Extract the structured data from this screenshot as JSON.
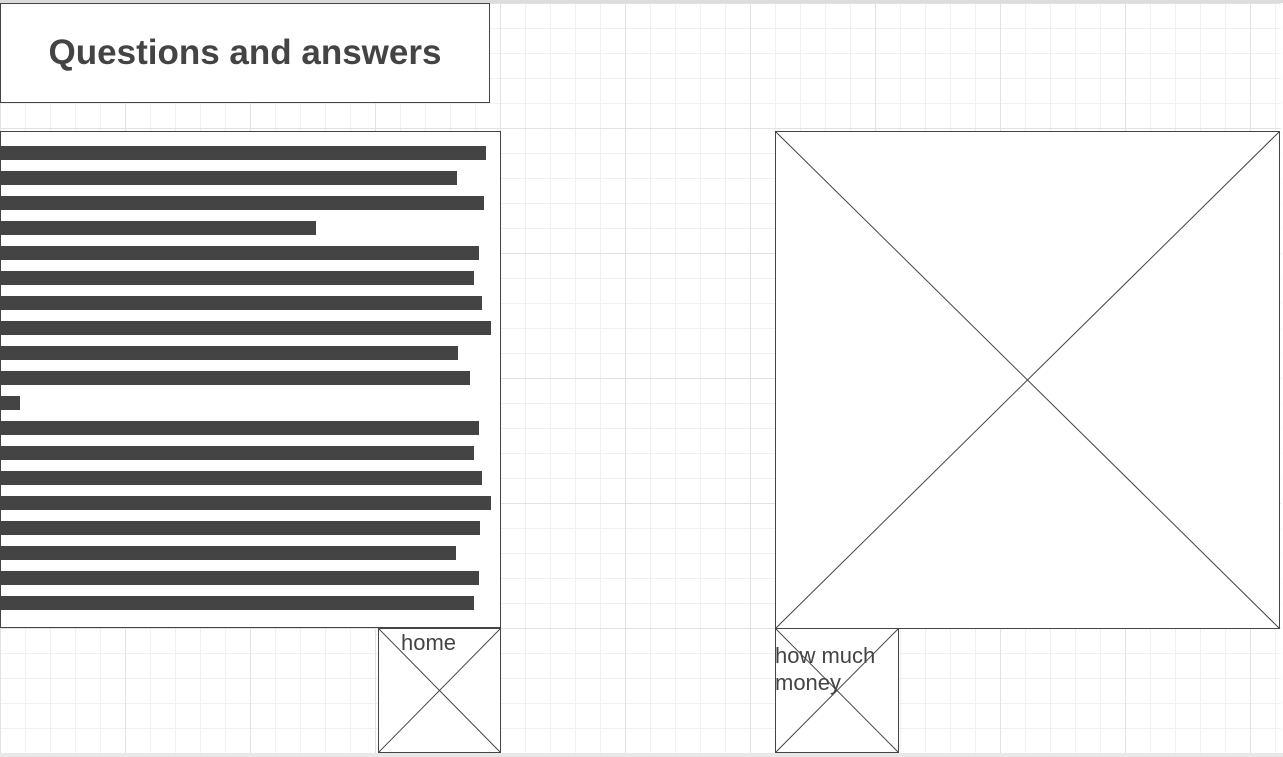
{
  "header": {
    "title": "Questions and answers"
  },
  "content": {
    "text_block": "redacted-text-lines"
  },
  "image_placeholder": {
    "icon": "image-placeholder-icon"
  },
  "nav": {
    "home_label": "home",
    "money_label": "how much money"
  },
  "colors": {
    "stroke": "#444444",
    "grid": "#e2e2e2"
  }
}
